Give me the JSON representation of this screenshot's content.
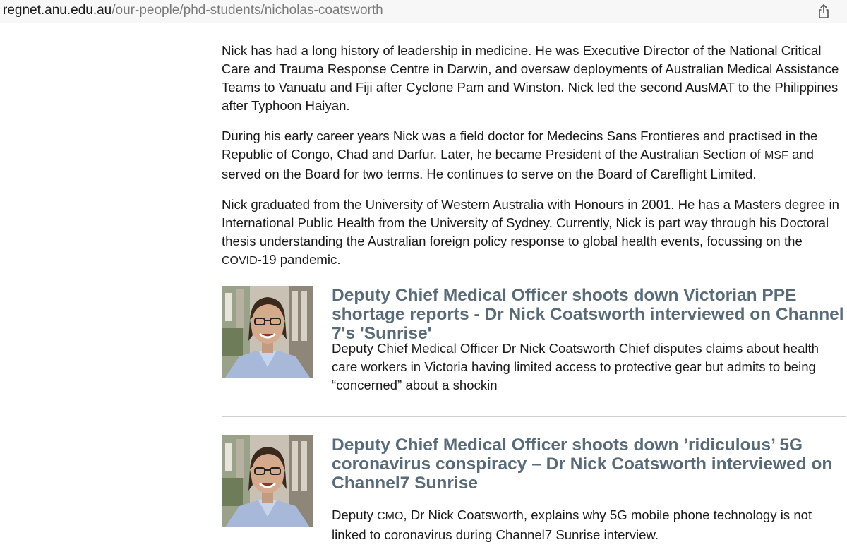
{
  "browser": {
    "url_domain": "regnet.anu.edu.au",
    "url_path": "/our-people/phd-students/nicholas-coatsworth",
    "share_icon": "share-icon"
  },
  "bio": {
    "p1": "Nick has had a long history of leadership in medicine. He was Executive Director of the National Critical Care and Trauma Response Centre in Darwin, and oversaw deployments of Australian Medical Assistance Teams to Vanuatu and Fiji after Cyclone Pam and Winston. Nick led the second AusMAT to the Philippines after Typhoon Haiyan.",
    "p2_a": "During his early career years Nick was a field doctor for Medecins Sans Frontieres and practised in the Republic of Congo, Chad and Darfur. Later, he became President of the Australian Section of ",
    "p2_abbr": "MSF",
    "p2_b": " and served on the Board for two terms. He continues to serve on the Board of Careflight Limited.",
    "p3_a": "Nick graduated from the University of Western Australia with Honours in 2001. He has a Masters degree in International Public Health from the University of Sydney. Currently, Nick is part way through his Doctoral thesis understanding the Australian foreign policy response to global health events, focussing on the ",
    "p3_abbr": "COVID",
    "p3_b": "-19 pandemic."
  },
  "articles": [
    {
      "headline": "Deputy Chief Medical Officer shoots down Victorian PPE shortage reports - Dr Nick Coatsworth interviewed on Channel 7's 'Sunrise'",
      "summary": "Deputy Chief Medical Officer Dr Nick Coatsworth Chief disputes claims about health care workers in Victoria having limited access to protective gear but admits to being “concerned” about a shockin"
    },
    {
      "headline": "Deputy Chief Medical Officer shoots down ’ridiculous’ 5G coronavirus conspiracy – Dr Nick Coatsworth interviewed on Channel7 Sunrise",
      "summary_a": "Deputy ",
      "summary_abbr": "CMO",
      "summary_b": ", Dr Nick Coatsworth, explains why 5G mobile phone technology is not linked to coronavirus during Channel7 Sunrise interview."
    }
  ]
}
